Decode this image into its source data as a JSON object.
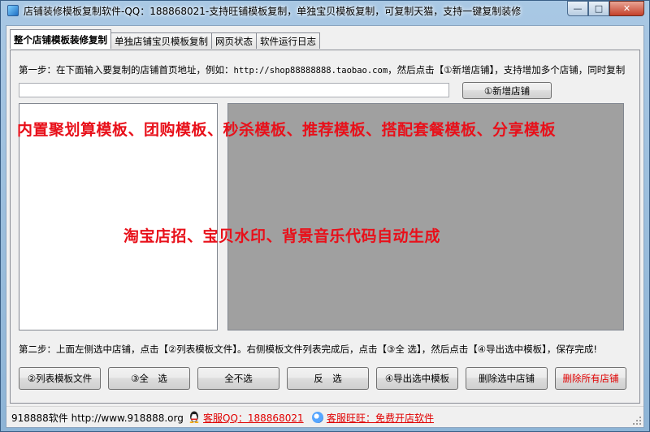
{
  "window": {
    "title": "店铺装修模板复制软件-QQ：188868021-支持旺铺模板复制，单独宝贝模板复制，可复制天猫，支持一键复制装修",
    "minimize_glyph": "—",
    "maximize_glyph": "□",
    "close_glyph": "✕"
  },
  "tabs": [
    {
      "label": "整个店铺模板装修复制"
    },
    {
      "label": "单独店铺宝贝模板复制"
    },
    {
      "label": "网页状态"
    },
    {
      "label": "软件运行日志"
    }
  ],
  "step1": {
    "prefix": "第一步：在下面输入要复制的店铺首页地址，例如：",
    "example_url": "http://shop88888888.taobao.com",
    "suffix": "，然后点击【①新增店铺】，支持增加多个店铺，同时复制",
    "url_input_value": "",
    "add_button": "①新增店铺"
  },
  "overlay": {
    "line1": "内置聚划算模板、团购模板、秒杀模板、推荐模板、搭配套餐模板、分享模板",
    "line2": "淘宝店招、宝贝水印、背景音乐代码自动生成"
  },
  "step2": {
    "text": "第二步：上面左侧选中店铺，点击【②列表模板文件】。右侧模板文件列表完成后，点击【③全 选】，然后点击【④导出选中模板】，保存完成!"
  },
  "buttons": {
    "list_templates": "②列表模板文件",
    "select_all": "③全　选",
    "select_none": "全不选",
    "invert": "反　选",
    "export_selected": "④导出选中模板",
    "delete_selected_shop": "删除选中店铺",
    "delete_all_shops": "删除所有店铺"
  },
  "status": {
    "site": "918888软件 http://www.918888.org",
    "qq": "客服QQ：188868021",
    "wangwang": "客服旺旺：免费开店软件"
  },
  "colors": {
    "accent_red": "#e8101a",
    "list_gray": "#a0a0a0"
  }
}
